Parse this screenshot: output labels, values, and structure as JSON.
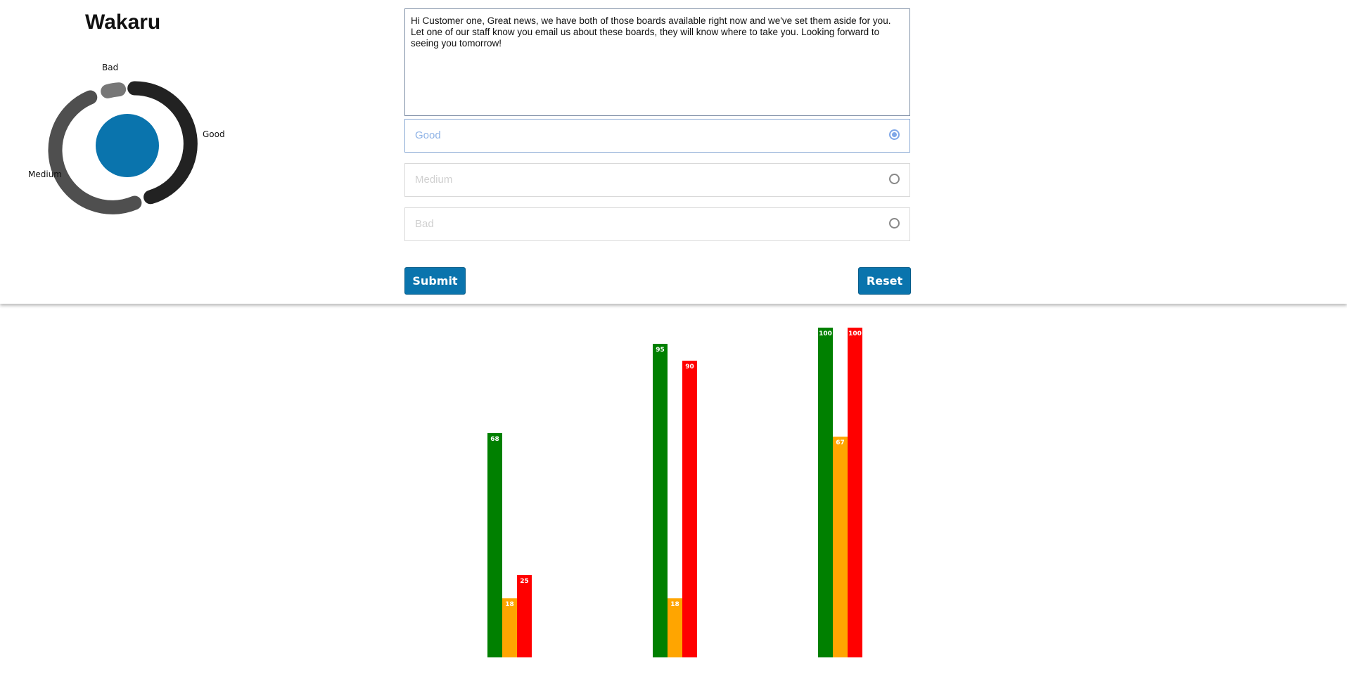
{
  "app": {
    "title": "Wakaru"
  },
  "sentiment_donut": {
    "labels": {
      "good": "Good",
      "medium": "Medium",
      "bad": "Bad"
    },
    "colors": {
      "good": "#222222",
      "medium": "#4f4f4f",
      "bad": "#777777",
      "center": "#0a74ad"
    }
  },
  "message": {
    "value": "Hi Customer one, Great news, we have both of those boards available right now and we've set them aside for you. Let one of our staff know you email us about these boards, they will know where to take you. Looking forward to seeing you tomorrow!"
  },
  "options": [
    {
      "label": "Good",
      "selected": true
    },
    {
      "label": "Medium",
      "selected": false
    },
    {
      "label": "Bad",
      "selected": false
    }
  ],
  "buttons": {
    "submit": "Submit",
    "reset": "Reset"
  },
  "chart_data": {
    "type": "bar",
    "series": [
      {
        "color": "#008000",
        "values": [
          68,
          95,
          100
        ]
      },
      {
        "color": "#ffa500",
        "values": [
          18,
          18,
          67
        ]
      },
      {
        "color": "#ff0000",
        "values": [
          25,
          90,
          100
        ]
      }
    ],
    "data_labels": true,
    "ylim": [
      0,
      100
    ],
    "grid": false,
    "legend": "none"
  }
}
